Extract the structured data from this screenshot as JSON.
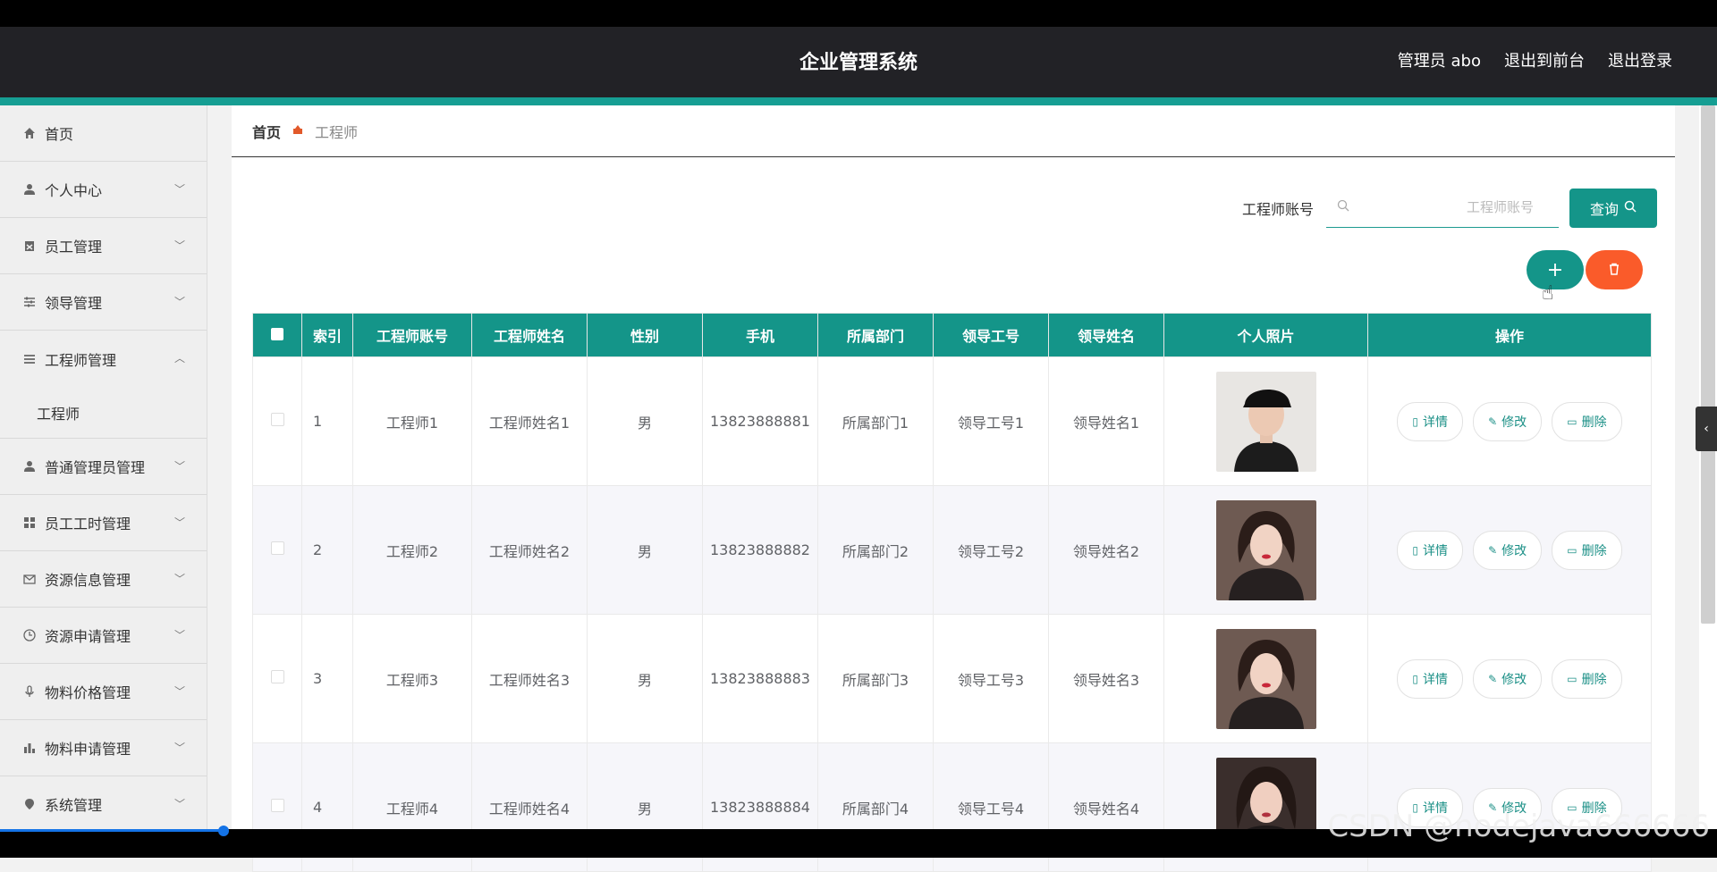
{
  "header": {
    "title": "企业管理系统",
    "admin": "管理员 abo",
    "to_front": "退出到前台",
    "logout": "退出登录"
  },
  "sidebar": {
    "items": [
      {
        "label": "首页",
        "icon": "home-icon"
      },
      {
        "label": "个人中心",
        "icon": "user-icon"
      },
      {
        "label": "员工管理",
        "icon": "clipboard-icon"
      },
      {
        "label": "领导管理",
        "icon": "sliders-icon"
      },
      {
        "label": "工程师管理",
        "icon": "list-icon"
      },
      {
        "label": "普通管理员管理",
        "icon": "user-icon"
      },
      {
        "label": "员工工时管理",
        "icon": "grid-icon"
      },
      {
        "label": "资源信息管理",
        "icon": "mail-icon"
      },
      {
        "label": "资源申请管理",
        "icon": "clock-icon"
      },
      {
        "label": "物料价格管理",
        "icon": "mic-icon"
      },
      {
        "label": "物料申请管理",
        "icon": "bar-chart-icon"
      },
      {
        "label": "系统管理",
        "icon": "pin-icon"
      }
    ],
    "submenu": "工程师"
  },
  "breadcrumb": {
    "home": "首页",
    "current": "工程师"
  },
  "search": {
    "label": "工程师账号",
    "placeholder": "工程师账号",
    "button": "查询"
  },
  "actions": {
    "add": "+"
  },
  "table": {
    "headers": [
      "索引",
      "工程师账号",
      "工程师姓名",
      "性别",
      "手机",
      "所属部门",
      "领导工号",
      "领导姓名",
      "个人照片",
      "操作"
    ],
    "rows": [
      {
        "idx": "1",
        "account": "工程师1",
        "name": "工程师姓名1",
        "gender": "男",
        "phone": "13823888881",
        "dept": "所属部门1",
        "leader_no": "领导工号1",
        "leader_name": "领导姓名1"
      },
      {
        "idx": "2",
        "account": "工程师2",
        "name": "工程师姓名2",
        "gender": "男",
        "phone": "13823888882",
        "dept": "所属部门2",
        "leader_no": "领导工号2",
        "leader_name": "领导姓名2"
      },
      {
        "idx": "3",
        "account": "工程师3",
        "name": "工程师姓名3",
        "gender": "男",
        "phone": "13823888883",
        "dept": "所属部门3",
        "leader_no": "领导工号3",
        "leader_name": "领导姓名3"
      },
      {
        "idx": "4",
        "account": "工程师4",
        "name": "工程师姓名4",
        "gender": "男",
        "phone": "13823888884",
        "dept": "所属部门4",
        "leader_no": "领导工号4",
        "leader_name": "领导姓名4"
      }
    ],
    "ops": {
      "detail": "详情",
      "edit": "修改",
      "delete": "删除"
    }
  },
  "watermark": "CSDN @nodejava666666",
  "colors": {
    "accent": "#149589",
    "danger": "#fa5b2a",
    "header_bg": "#222226"
  }
}
